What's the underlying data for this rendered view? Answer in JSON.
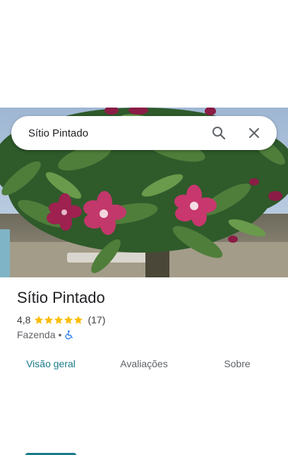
{
  "search": {
    "query": "Sítio Pintado"
  },
  "icons": {
    "search": "search-icon",
    "close": "close-icon",
    "star": "star-icon",
    "accessibility": "wheelchair-icon"
  },
  "place": {
    "name": "Sítio Pintado",
    "rating": "4,8",
    "stars": 5,
    "review_count": "(17)",
    "category": "Fazenda",
    "separator": "•"
  },
  "tabs": [
    {
      "label": "Visão geral",
      "active": true
    },
    {
      "label": "Avaliações",
      "active": false
    },
    {
      "label": "Sobre",
      "active": false
    }
  ],
  "colors": {
    "accent": "#1a7a8a",
    "star": "#fbbc04",
    "accessibility": "#1a73e8"
  }
}
